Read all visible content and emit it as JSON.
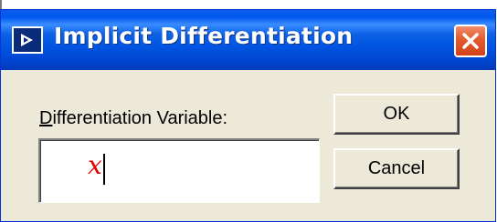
{
  "dialog": {
    "title": "Implicit Differentiation",
    "icon": "app-icon",
    "close_icon": "close-icon"
  },
  "form": {
    "label_accel": "D",
    "label_rest": "ifferentiation Variable:",
    "input_value": "x"
  },
  "buttons": {
    "ok_label": "OK",
    "cancel_label": "Cancel"
  },
  "colors": {
    "titlebar": "#0055e3",
    "dialog_bg": "#ece9d8",
    "close_button": "#e35a2c",
    "input_text": "#e00000"
  }
}
